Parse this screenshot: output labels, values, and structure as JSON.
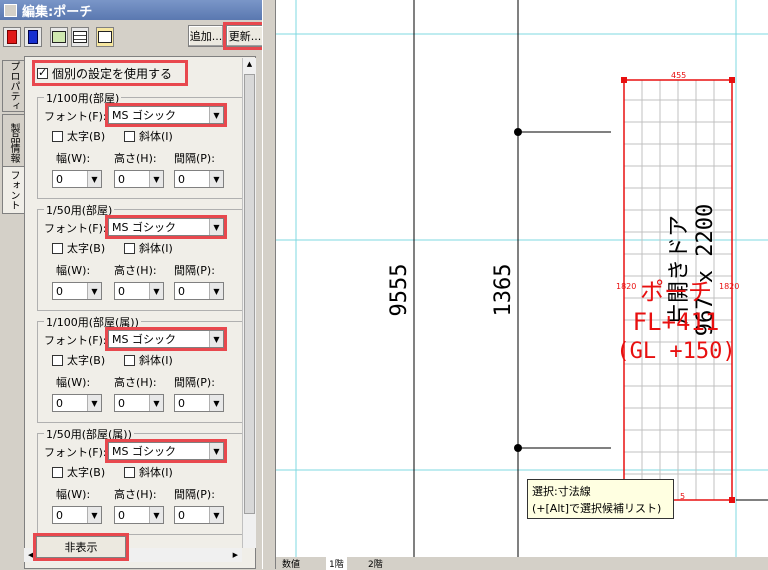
{
  "window": {
    "title": "編集:ポーチ"
  },
  "toolbar": {
    "add_label": "追加...",
    "update_label": "更新..."
  },
  "tabs": [
    "プロパティ",
    "製品情報",
    "フォント"
  ],
  "use_individual": {
    "label": "個別の設定を使用する",
    "checked": true
  },
  "labels": {
    "font": "フォント(F):",
    "bold": "太字(B)",
    "italic": "斜体(I)",
    "width": "幅(W):",
    "height": "高さ(H):",
    "spacing": "間隔(P):"
  },
  "groups": [
    {
      "title": "1/100用(部屋)",
      "font": "MS ゴシック",
      "width": "0",
      "height": "0",
      "spacing": "0"
    },
    {
      "title": "1/50用(部屋)",
      "font": "MS ゴシック",
      "width": "0",
      "height": "0",
      "spacing": "0"
    },
    {
      "title": "1/100用(部屋(属))",
      "font": "MS ゴシック",
      "width": "0",
      "height": "0",
      "spacing": "0"
    },
    {
      "title": "1/50用(部屋(属))",
      "font": "MS ゴシック",
      "width": "0",
      "height": "0",
      "spacing": "0"
    }
  ],
  "hide_button": "非表示",
  "drawing": {
    "dim_9555": "9555",
    "dim_1365": "1365",
    "dim_455": "455",
    "dim_1820_left": "1820",
    "dim_1820_right": "1820",
    "dim_5": "5",
    "door_label": "片開きドア",
    "door_size": "967 x 2200",
    "porch_name": "ポーチ",
    "fl": "FL+411",
    "gl": "(GL +150)"
  },
  "tooltip": {
    "line1": "選択:寸法線",
    "line2": "(+[Alt]で選択候補リスト)"
  },
  "bottom_tabs": [
    "数値",
    "1階",
    "2階"
  ],
  "colors": {
    "highlight": "#e8484e",
    "grid": "#7fd8e0",
    "red": "#e81010"
  }
}
